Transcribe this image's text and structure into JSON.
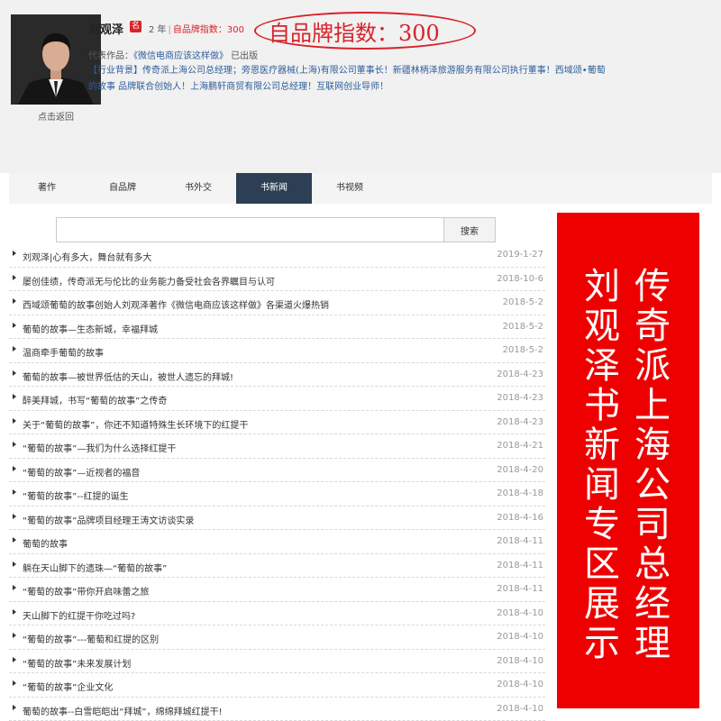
{
  "profile": {
    "name": "刘观泽",
    "badge_icon": "名",
    "years": "2 年",
    "separator": "|",
    "index_label": "自品牌指数：300",
    "back_label": "点击返回"
  },
  "callout": {
    "text": "自品牌指数：300",
    "color": "#d8232a"
  },
  "works": {
    "label": "代表作品：",
    "title": "《微信电商应该这样做》",
    "suffix": " 已出版"
  },
  "bio": "【行业背景】传奇派上海公司总经理；旁恩医疗器械(上海)有限公司董事长！新疆林柄泽旅游服务有限公司执行董事！西域颂•葡萄的故事 品牌联合创始人！上海鹏轩商贸有限公司总经理！互联网创业导师！",
  "tabs": [
    {
      "label": "著作",
      "active": false
    },
    {
      "label": "自品牌",
      "active": false
    },
    {
      "label": "书外交",
      "active": false
    },
    {
      "label": "书新闻",
      "active": true
    },
    {
      "label": "书视频",
      "active": false
    }
  ],
  "search": {
    "value": "",
    "button_label": "搜索"
  },
  "news": [
    {
      "title": "刘观泽|心有多大，舞台就有多大",
      "date": "2019-1-27"
    },
    {
      "title": "屡创佳绩，传奇派无与伦比的业务能力备受社会各界瞩目与认可",
      "date": "2018-10-6"
    },
    {
      "title": "西域颂葡萄的故事创始人刘观泽著作《微信电商应该这样做》各渠道火爆热销",
      "date": "2018-5-2"
    },
    {
      "title": "葡萄的故事—生态新城，幸福拜城",
      "date": "2018-5-2"
    },
    {
      "title": "温商牵手葡萄的故事",
      "date": "2018-5-2"
    },
    {
      "title": "葡萄的故事—被世界低估的天山，被世人遗忘的拜城!",
      "date": "2018-4-23"
    },
    {
      "title": "醉美拜城，书写“葡萄的故事”之传奇",
      "date": "2018-4-23"
    },
    {
      "title": "关于“葡萄的故事”，你还不知道特殊生长环境下的红提干",
      "date": "2018-4-23"
    },
    {
      "title": "“葡萄的故事”—我们为什么选择红提干",
      "date": "2018-4-21"
    },
    {
      "title": "“葡萄的故事”—近视者的福音",
      "date": "2018-4-20"
    },
    {
      "title": "“葡萄的故事”--红提的诞生",
      "date": "2018-4-18"
    },
    {
      "title": "“葡萄的故事”品牌项目经理王涛文访谈实录",
      "date": "2018-4-16"
    },
    {
      "title": "葡萄的故事",
      "date": "2018-4-11"
    },
    {
      "title": "躺在天山脚下的遗珠—“葡萄的故事”",
      "date": "2018-4-11"
    },
    {
      "title": "“葡萄的故事”带你开启味蕾之旅",
      "date": "2018-4-11"
    },
    {
      "title": "天山脚下的红提干你吃过吗?",
      "date": "2018-4-10"
    },
    {
      "title": "“葡萄的故事”---葡萄和红提的区别",
      "date": "2018-4-10"
    },
    {
      "title": "“葡萄的故事”未来发展计划",
      "date": "2018-4-10"
    },
    {
      "title": "“葡萄的故事”企业文化",
      "date": "2018-4-10"
    },
    {
      "title": "葡萄的故事--白雪皑皑出“拜城”，绵绵拜城红提干!",
      "date": "2018-4-10"
    }
  ],
  "banner": {
    "line1": "传奇派上海公司总经理",
    "line2": "刘观泽书新闻专区展示",
    "color": "#ee0000"
  },
  "colors": {
    "tab_active": "#2c3f54",
    "accent_red": "#d8232a",
    "link_blue": "#2e5d9b"
  }
}
